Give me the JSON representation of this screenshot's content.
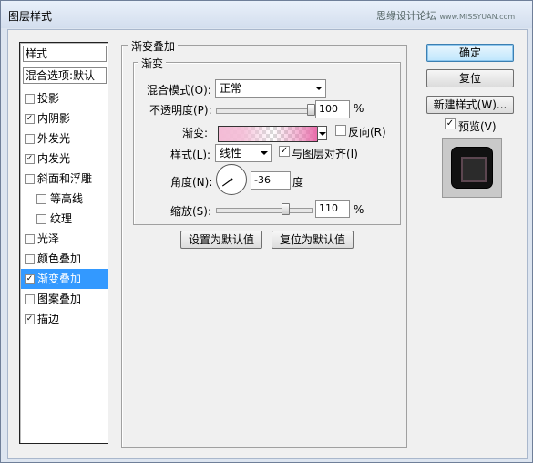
{
  "window": {
    "title": "图层样式",
    "watermark_text": "思缘设计论坛",
    "watermark_site": "www.MISSYUAN.com"
  },
  "styles_list": {
    "header": "样式",
    "blend_options": "混合选项:默认",
    "items": [
      {
        "label": "投影",
        "checked": false,
        "selected": false,
        "indent": false
      },
      {
        "label": "内阴影",
        "checked": true,
        "selected": false,
        "indent": false
      },
      {
        "label": "外发光",
        "checked": false,
        "selected": false,
        "indent": false
      },
      {
        "label": "内发光",
        "checked": true,
        "selected": false,
        "indent": false
      },
      {
        "label": "斜面和浮雕",
        "checked": false,
        "selected": false,
        "indent": false
      },
      {
        "label": "等高线",
        "checked": false,
        "selected": false,
        "indent": true
      },
      {
        "label": "纹理",
        "checked": false,
        "selected": false,
        "indent": true
      },
      {
        "label": "光泽",
        "checked": false,
        "selected": false,
        "indent": false
      },
      {
        "label": "颜色叠加",
        "checked": false,
        "selected": false,
        "indent": false
      },
      {
        "label": "渐变叠加",
        "checked": true,
        "selected": true,
        "indent": false
      },
      {
        "label": "图案叠加",
        "checked": false,
        "selected": false,
        "indent": false
      },
      {
        "label": "描边",
        "checked": true,
        "selected": false,
        "indent": false
      }
    ]
  },
  "panel": {
    "group_title": "渐变叠加",
    "subgroup_title": "渐变",
    "blend_mode_label": "混合模式(O):",
    "blend_mode_value": "正常",
    "opacity_label": "不透明度(P):",
    "opacity_value": "100",
    "opacity_unit": "%",
    "opacity_level": 1.0,
    "gradient_label": "渐变:",
    "reverse_label": "反向(R)",
    "reverse_checked": false,
    "style_label": "样式(L):",
    "style_value": "线性",
    "align_label": "与图层对齐(I)",
    "align_checked": true,
    "angle_label": "角度(N):",
    "angle_value": "-36",
    "angle_unit": "度",
    "scale_label": "缩放(S):",
    "scale_value": "110",
    "scale_unit": "%",
    "scale_level": 0.733,
    "set_default_button": "设置为默认值",
    "reset_default_button": "复位为默认值"
  },
  "buttons": {
    "ok": "确定",
    "reset": "复位",
    "new_style": "新建样式(W)...",
    "preview_label": "预览(V)",
    "preview_checked": true
  },
  "colors": {
    "selection": "#3399ff",
    "gradient_light": "#f4bcd6",
    "gradient_dark": "#e96caa"
  }
}
